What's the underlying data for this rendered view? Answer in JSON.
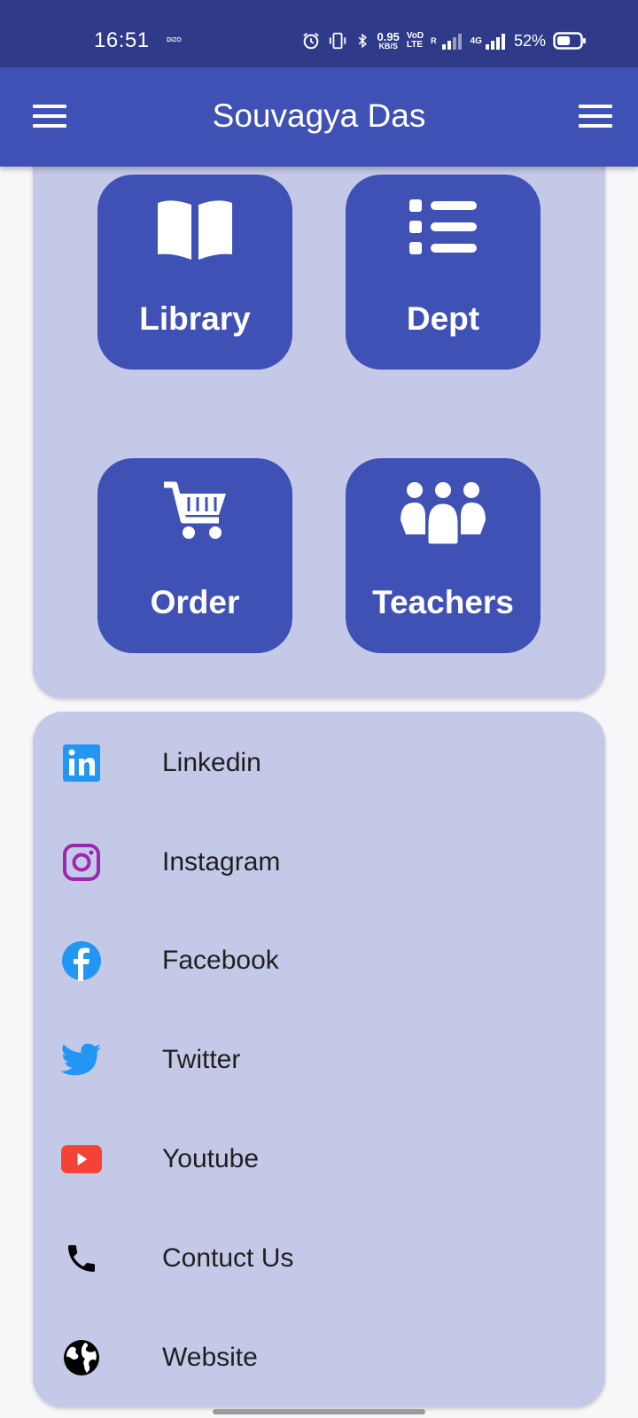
{
  "status_bar": {
    "time": "16:51",
    "carrier_badge": "DIZO",
    "net_speed_value": "0.95",
    "net_speed_unit": "KB/S",
    "volte_top": "VoD",
    "volte_bottom": "LTE",
    "roaming": "R",
    "network_type": "4G",
    "battery_percent": "52%",
    "icons": [
      "alarm-icon",
      "vibrate-icon",
      "bluetooth-icon",
      "signal-icon",
      "battery-icon"
    ]
  },
  "app_bar": {
    "title": "Souvagya Das",
    "left_icon": "menu-icon",
    "right_icon": "menu-icon",
    "background_color": "#3f51b5"
  },
  "grid": {
    "tiles": [
      {
        "label": "Library",
        "icon": "open-book-icon"
      },
      {
        "label": "Dept",
        "icon": "list-icon"
      },
      {
        "label": "Order",
        "icon": "shopping-cart-icon"
      },
      {
        "label": "Teachers",
        "icon": "people-icon"
      }
    ]
  },
  "links": {
    "items": [
      {
        "label": "Linkedin",
        "icon": "linkedin-icon",
        "color": "#2196f3"
      },
      {
        "label": "Instagram",
        "icon": "instagram-icon",
        "color": "#9c27b0"
      },
      {
        "label": "Facebook",
        "icon": "facebook-icon",
        "color": "#2196f3"
      },
      {
        "label": "Twitter",
        "icon": "twitter-icon",
        "color": "#2196f3"
      },
      {
        "label": "Youtube",
        "icon": "youtube-icon",
        "color": "#f44336"
      },
      {
        "label": "Contuct Us",
        "icon": "phone-icon",
        "color": "#000000"
      },
      {
        "label": "Website",
        "icon": "globe-icon",
        "color": "#000000"
      }
    ]
  },
  "colors": {
    "status_bar": "#2f3b88",
    "primary": "#3f51b5",
    "card_background": "#c5c9e8",
    "page_background": "#f7f7f9"
  }
}
